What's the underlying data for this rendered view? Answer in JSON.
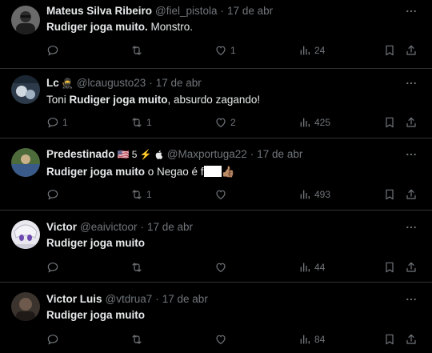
{
  "tweets": [
    {
      "name": "Mateus Silva Ribeiro",
      "badges": "",
      "handle": "@fiel_pistola",
      "date": "17 de abr",
      "text_bold": "Rudiger joga muito.",
      "text_rest": " Monstro.",
      "text_pre": "",
      "replies": "",
      "retweets": "",
      "likes": "1",
      "views": "24"
    },
    {
      "name": "Lc",
      "badges": "🥷",
      "handle": "@lcaugusto23",
      "date": "17 de abr",
      "text_pre": "Toni ",
      "text_bold": "Rudiger joga muito",
      "text_rest": ", absurdo zagando!",
      "replies": "1",
      "retweets": "1",
      "likes": "2",
      "views": "425"
    },
    {
      "name": "Predestinado",
      "badges": "🇺🇸 5 ⚡",
      "handle": "@Maxportuga22",
      "date": "17 de abr",
      "text_pre": "",
      "text_bold": "Rudiger joga muito",
      "text_rest": " o Negao é f",
      "text_tail": "👍🏽",
      "replies": "",
      "retweets": "1",
      "likes": "",
      "views": "493"
    },
    {
      "name": "Victor",
      "badges": "",
      "handle": "@eaivictoor",
      "date": "17 de abr",
      "text_pre": "",
      "text_bold": "Rudiger joga muito",
      "text_rest": "",
      "replies": "",
      "retweets": "",
      "likes": "",
      "views": "44"
    },
    {
      "name": "Victor Luis",
      "badges": "",
      "handle": "@vtdrua7",
      "date": "17 de abr",
      "text_pre": "",
      "text_bold": "Rudiger joga muito",
      "text_rest": "",
      "replies": "",
      "retweets": "",
      "likes": "",
      "views": "84"
    }
  ],
  "separator": "·",
  "icons": {
    "reply": "reply-icon",
    "retweet": "retweet-icon",
    "like": "heart-icon",
    "views": "views-icon",
    "bookmark": "bookmark-icon",
    "share": "share-icon",
    "more": "more-icon",
    "apple": "apple-icon"
  },
  "colors": {
    "background": "#000000",
    "text": "#e7e9ea",
    "muted": "#71767b",
    "divider": "#2f3336"
  }
}
